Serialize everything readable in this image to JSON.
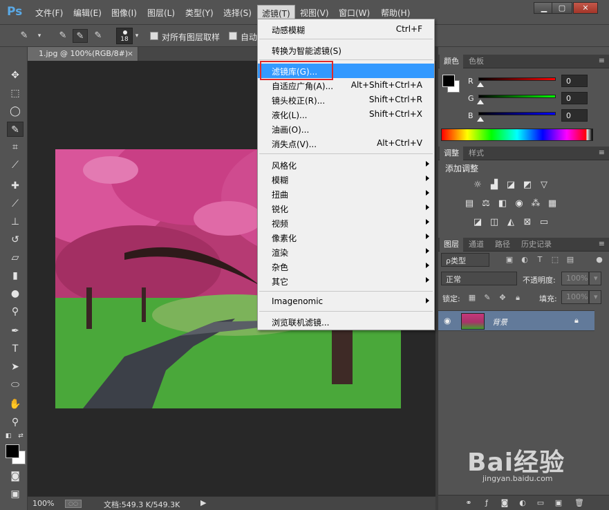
{
  "app": {
    "logo": "Ps"
  },
  "menubar": {
    "items": [
      "文件(F)",
      "编辑(E)",
      "图像(I)",
      "图层(L)",
      "类型(Y)",
      "选择(S)",
      "滤镜(T)",
      "视图(V)",
      "窗口(W)",
      "帮助(H)"
    ],
    "active_item": "滤镜(T)"
  },
  "options": {
    "brush_size": "18",
    "sample_all_layers": "对所有图层取样",
    "auto_enhance": "自动"
  },
  "document": {
    "tab_title": "1.jpg @ 100%(RGB/8#)",
    "close": "×",
    "zoom": "100%",
    "doc_info": "文档:549.3 K/549.3K"
  },
  "filter_menu": {
    "items": [
      {
        "label": "动感模糊",
        "shortcut": "Ctrl+F"
      },
      {
        "label": "转换为智能滤镜(S)",
        "shortcut": ""
      },
      {
        "label": "滤镜库(G)...",
        "shortcut": "",
        "highlight": true
      },
      {
        "label": "自适应广角(A)...",
        "shortcut": "Alt+Shift+Ctrl+A"
      },
      {
        "label": "镜头校正(R)...",
        "shortcut": "Shift+Ctrl+R"
      },
      {
        "label": "液化(L)...",
        "shortcut": "Shift+Ctrl+X"
      },
      {
        "label": "油画(O)...",
        "shortcut": ""
      },
      {
        "label": "消失点(V)...",
        "shortcut": "Alt+Ctrl+V"
      },
      {
        "label": "风格化",
        "submenu": true
      },
      {
        "label": "模糊",
        "submenu": true
      },
      {
        "label": "扭曲",
        "submenu": true
      },
      {
        "label": "锐化",
        "submenu": true
      },
      {
        "label": "视频",
        "submenu": true
      },
      {
        "label": "像素化",
        "submenu": true
      },
      {
        "label": "渲染",
        "submenu": true
      },
      {
        "label": "杂色",
        "submenu": true
      },
      {
        "label": "其它",
        "submenu": true
      },
      {
        "label": "Imagenomic",
        "submenu": true
      },
      {
        "label": "浏览联机滤镜..."
      }
    ]
  },
  "color_panel": {
    "tabs": [
      "颜色",
      "色板"
    ],
    "channels": [
      {
        "label": "R",
        "value": "0",
        "color": "#cc0000"
      },
      {
        "label": "G",
        "value": "0",
        "color": "#00aa00"
      },
      {
        "label": "B",
        "value": "0",
        "color": "#0000cc"
      }
    ]
  },
  "adjust_panel": {
    "tabs": [
      "调整",
      "样式"
    ],
    "title": "添加调整"
  },
  "layers_panel": {
    "tabs": [
      "图层",
      "通道",
      "路径",
      "历史记录"
    ],
    "filter_kind": "ρ类型",
    "blend_mode": "正常",
    "opacity_label": "不透明度:",
    "opacity_value": "100%",
    "lock_label": "锁定:",
    "fill_label": "填充:",
    "fill_value": "100%",
    "layer_name": "背景"
  },
  "watermark": {
    "main": "Bai经验",
    "sub": "jingyan.baidu.com"
  }
}
